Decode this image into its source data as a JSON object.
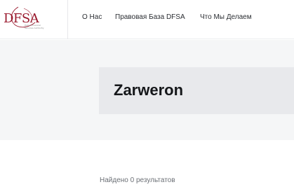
{
  "header": {
    "logo": {
      "letters": "DFSA",
      "tagline_line1": "Dubai Financial",
      "tagline_line2": "Services Authority",
      "brand_color": "#9a1a2e"
    },
    "nav": [
      {
        "label": "О Нас"
      },
      {
        "label": "Правовая База DFSA"
      },
      {
        "label": "Что Мы Делаем"
      }
    ]
  },
  "main": {
    "title": "Zarweron",
    "results_text": "Найдено 0 результатов"
  },
  "colors": {
    "hero_background": "#f5f6f7",
    "title_box_background": "#e8e9ec",
    "nav_text": "#2b2e33"
  }
}
